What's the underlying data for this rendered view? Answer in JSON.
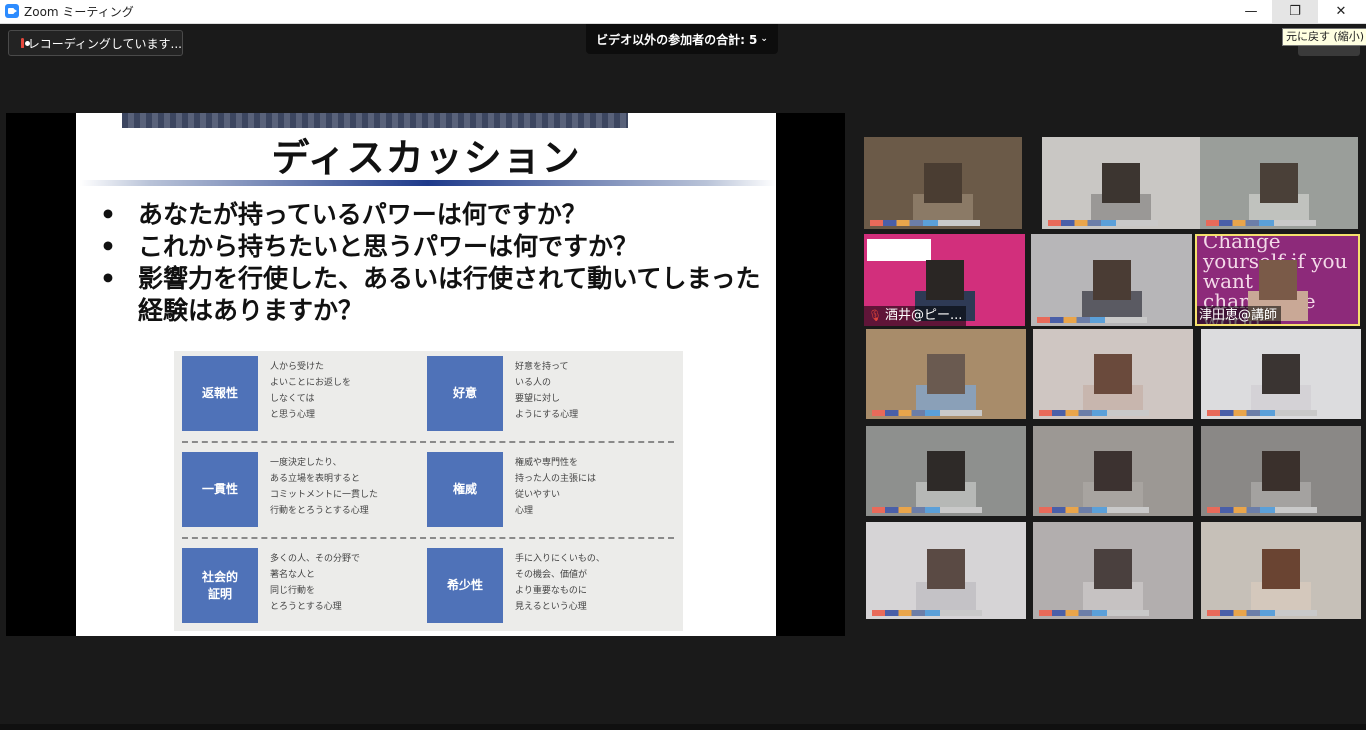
{
  "window": {
    "title": "Zoom ミーティング",
    "icon": "zoom-icon"
  },
  "window_controls": {
    "minimize": "—",
    "restore": "❐",
    "close": "✕",
    "restore_tooltip": "元に戻す (縮小)"
  },
  "recording": {
    "label": "レコーディングしています..."
  },
  "participants_bar": {
    "label": "ビデオ以外の参加者の合計: 5",
    "chevron": "⌄"
  },
  "slide": {
    "title": "ディスカッション",
    "bullets": [
      "あなたが持っているパワーは何ですか？",
      "これから持ちたいと思うパワーは何ですか？",
      "影響力を行使した、あるいは行使されて動いてしまった経験はありますか？"
    ],
    "bullet_marker": "•",
    "diagram": [
      {
        "label": "返報性",
        "desc": "人から受けた\nよいことにお返しを\nしなくては\nと思う心理"
      },
      {
        "label": "好意",
        "desc": "好意を持って\nいる人の\n要望に対し\nようにする心理"
      },
      {
        "label": "一貫性",
        "desc": "一度決定したり、\nある立場を表明すると\nコミットメントに一貫した\n行動をとろうとする心理"
      },
      {
        "label": "権威",
        "desc": "権威や専門性を\n持った人の主張には\n従いやすい\n心理"
      },
      {
        "label": "社会的\n証明",
        "desc": "多くの人、その分野で\n著名な人と\n同じ行動を\nとろうとする心理"
      },
      {
        "label": "希少性",
        "desc": "手に入りにくいもの、\nその機会、価値が\nより重要なものに\n見えるという心理"
      }
    ]
  },
  "gallery": {
    "tiles": [
      {
        "name": "",
        "bg": "#6b5a48",
        "face": "#4a3d32",
        "body": "#8b7a66"
      },
      {
        "name": "",
        "bg": "#c9c7c4",
        "face": "#3c3530",
        "body": "#9a9896"
      },
      {
        "name": "",
        "bg": "#9a9e9a",
        "face": "#4a4038",
        "body": "#c0c2be"
      },
      {
        "name": "酒井@ピー...",
        "bg": "#d22f7c",
        "face": "#2a2624",
        "body": "#2e3a55",
        "muted": true
      },
      {
        "name": "",
        "bg": "#b7b6b8",
        "face": "#4a3c34",
        "body": "#5a5a62"
      },
      {
        "name": "津田恵@講師",
        "bg": "#8d2a7a",
        "face": "#7a5a48",
        "body": "#c9a896",
        "active": true,
        "letters": "Change yourself if you want to change the world"
      },
      {
        "name": "",
        "bg": "#a88c6a",
        "face": "#6a5a50",
        "body": "#8aa0b8"
      },
      {
        "name": "",
        "bg": "#cfc6c2",
        "face": "#6a4a3c",
        "body": "#c8b6ae"
      },
      {
        "name": "",
        "bg": "#dcdcde",
        "face": "#3a3432",
        "body": "#d4d2d6"
      },
      {
        "name": "",
        "bg": "#8e908e",
        "face": "#2e2a28",
        "body": "#b6b8b6"
      },
      {
        "name": "",
        "bg": "#9c9894",
        "face": "#3c3230",
        "body": "#a8a4a0"
      },
      {
        "name": "",
        "bg": "#8a8886",
        "face": "#3a302c",
        "body": "#a4a2a0"
      },
      {
        "name": "",
        "bg": "#d6d4d6",
        "face": "#5a4a44",
        "body": "#c4c2c6"
      },
      {
        "name": "",
        "bg": "#b2aeae",
        "face": "#4a403e",
        "body": "#c6c2c2"
      },
      {
        "name": "",
        "bg": "#c6c0b8",
        "face": "#6a4432",
        "body": "#d4c8bc"
      }
    ]
  }
}
